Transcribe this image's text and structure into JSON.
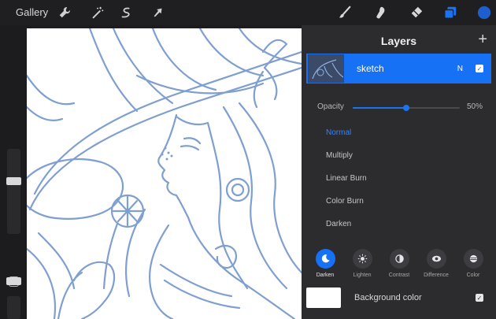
{
  "toolbar": {
    "gallery_label": "Gallery",
    "left_icons": [
      "wrench-icon",
      "magic-wand-icon",
      "selection-icon",
      "transform-arrow-icon"
    ],
    "right_icons": [
      "brush-icon",
      "smudge-icon",
      "eraser-icon",
      "layers-icon",
      "color-swatch-icon"
    ],
    "active_color": "#1e5fcf"
  },
  "canvas": {
    "line_color": "#7f9fd0"
  },
  "layers_panel": {
    "title": "Layers",
    "add_label": "+",
    "layer": {
      "name": "sketch",
      "blend_letter": "N",
      "visible": true
    },
    "opacity": {
      "label": "Opacity",
      "value_label": "50%",
      "value": 0.5
    },
    "blend_modes": [
      {
        "label": "Normal",
        "active": true
      },
      {
        "label": "Multiply",
        "active": false
      },
      {
        "label": "Linear Burn",
        "active": false
      },
      {
        "label": "Color Burn",
        "active": false
      },
      {
        "label": "Darken",
        "active": false
      }
    ],
    "categories": [
      {
        "label": "Darken",
        "icon": "moon-icon",
        "active": true
      },
      {
        "label": "Lighten",
        "icon": "sun-icon",
        "active": false
      },
      {
        "label": "Contrast",
        "icon": "contrast-icon",
        "active": false
      },
      {
        "label": "Difference",
        "icon": "difference-icon",
        "active": false
      },
      {
        "label": "Color",
        "icon": "color-blend-icon",
        "active": false
      }
    ],
    "background": {
      "label": "Background color",
      "visible": true
    },
    "accent": "#1671f5"
  },
  "sidebar": {
    "brush_size": 0.42,
    "brush_opacity": 0.15
  }
}
